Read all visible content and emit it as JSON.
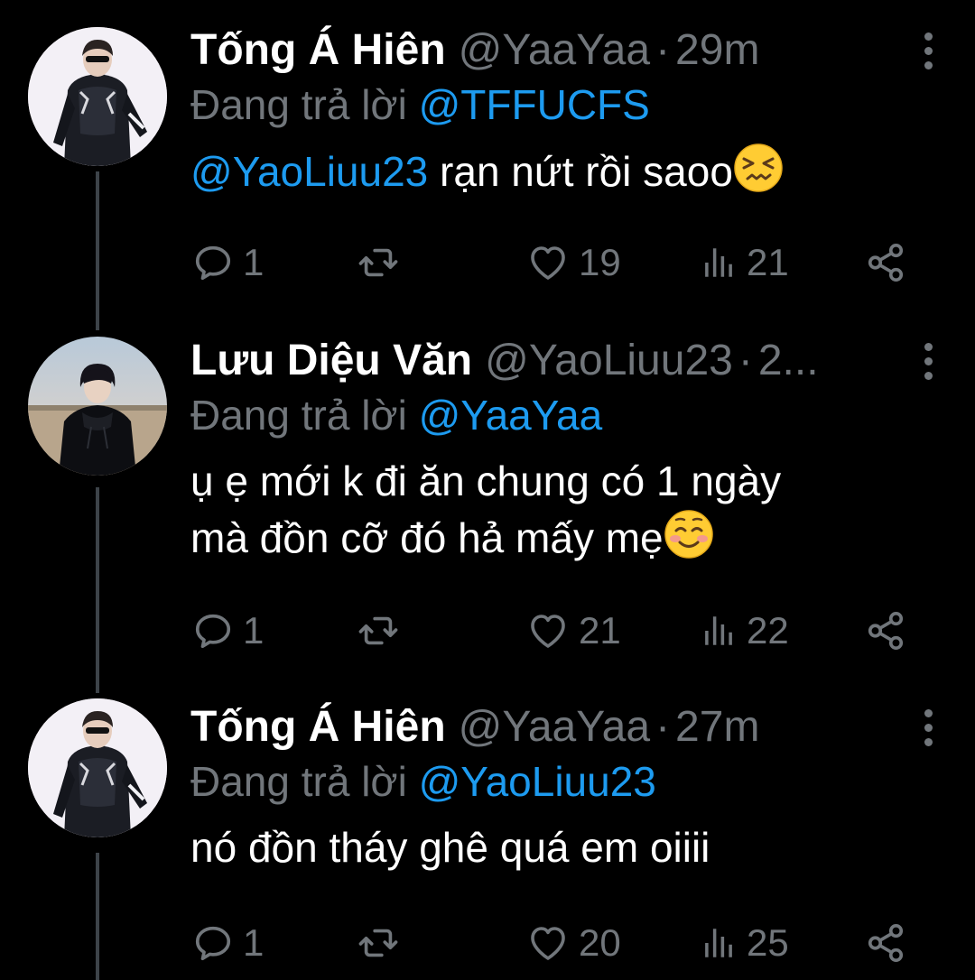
{
  "tweets": [
    {
      "name": "Tống Á Hiên",
      "handle": "@YaaYaa",
      "separator": "·",
      "time": "29m",
      "reply_prefix": "Đang trả lời",
      "reply_to": "@TFFUCFS",
      "mention": "@YaoLiuu23",
      "text": "rạn nứt rồi saoo",
      "emoji": "confounded-face",
      "replies": "1",
      "likes": "19",
      "views": "21",
      "avatar": "person-white-background"
    },
    {
      "name": "Lưu Diệu Văn",
      "handle": "@YaoLiuu23",
      "separator": "·",
      "time": "2...",
      "reply_prefix": "Đang trả lời",
      "reply_to": "@YaaYaa",
      "text_line1": "ụ ẹ mới k đi ăn chung có 1 ngày",
      "text_line2": "mà đồn cỡ đó hả mấy mẹ",
      "emoji": "smiling-face",
      "replies": "1",
      "likes": "21",
      "views": "22",
      "avatar": "person-desert-sky"
    },
    {
      "name": "Tống Á Hiên",
      "handle": "@YaaYaa",
      "separator": "·",
      "time": "27m",
      "reply_prefix": "Đang trả lời",
      "reply_to": "@YaoLiuu23",
      "text": "nó đồn tháy ghê quá em oiiii",
      "replies": "1",
      "likes": "20",
      "views": "25",
      "avatar": "person-white-background"
    }
  ],
  "colors": {
    "background": "#000000",
    "name": "#ffffff",
    "secondary": "#71767b",
    "link": "#1d9bf0",
    "thread_line": "#3d4349"
  },
  "icons": [
    "reply-icon",
    "retweet-icon",
    "like-icon",
    "views-icon",
    "share-icon",
    "more-icon"
  ]
}
